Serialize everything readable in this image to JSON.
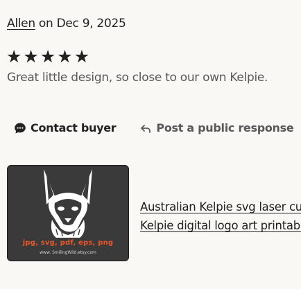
{
  "review": {
    "reviewer": "Allen",
    "on": "on",
    "date": "Dec 9, 2025",
    "rating": 5,
    "text": "Great little design, so close to our own Kelpie."
  },
  "actions": {
    "contact_label": "Contact buyer",
    "respond_label": "Post a public response"
  },
  "listing": {
    "title_line1": "Australian Kelpie svg laser cut file.",
    "title_line2": "Kelpie digital logo art printable",
    "thumb_formats": "jpg, svg, pdf, eps, png",
    "thumb_site": "www. SmilingWild.etsy.com"
  },
  "colors": {
    "background": "#f9f8f4",
    "text": "#222222",
    "muted": "#595959",
    "thumb_accent": "#e8572a"
  }
}
